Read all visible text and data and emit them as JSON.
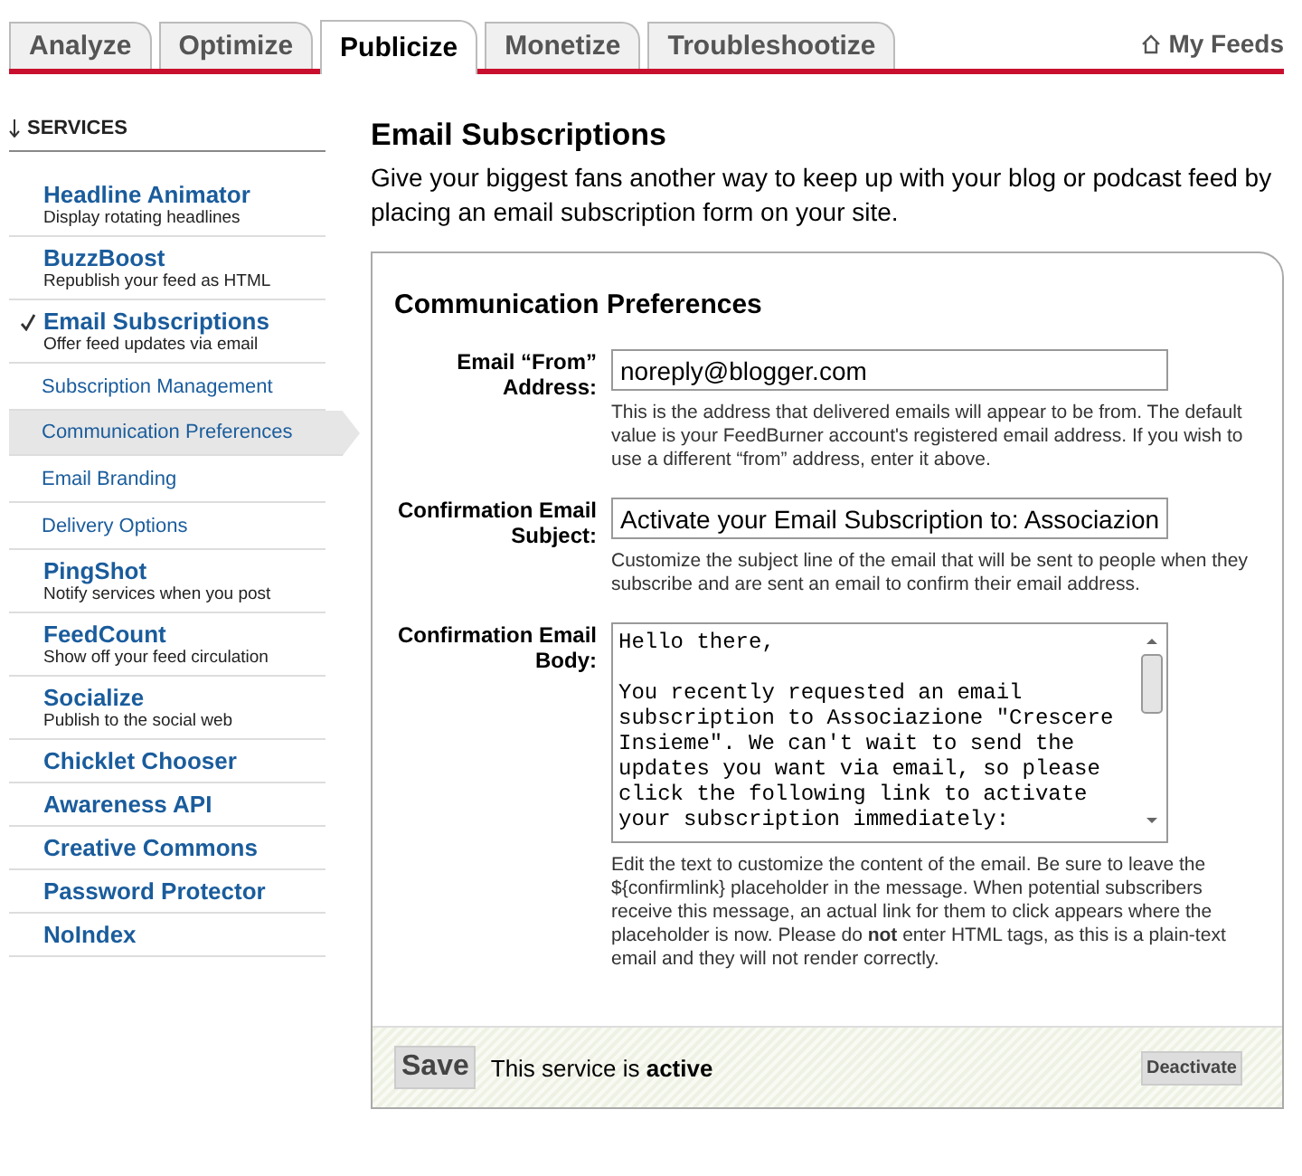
{
  "tabs": [
    {
      "label": "Analyze",
      "selected": false
    },
    {
      "label": "Optimize",
      "selected": false
    },
    {
      "label": "Publicize",
      "selected": true
    },
    {
      "label": "Monetize",
      "selected": false
    },
    {
      "label": "Troubleshootize",
      "selected": false
    }
  ],
  "my_feeds": {
    "label": "My Feeds"
  },
  "sidebar": {
    "heading": "SERVICES",
    "items": [
      {
        "kind": "service",
        "title": "Headline Animator",
        "description": "Display rotating headlines",
        "checked": false
      },
      {
        "kind": "service",
        "title": "BuzzBoost",
        "description": "Republish your feed as HTML",
        "checked": false
      },
      {
        "kind": "service",
        "title": "Email Subscriptions",
        "description": "Offer feed updates via email",
        "checked": true,
        "children": [
          {
            "title": "Subscription Management",
            "selected": false
          },
          {
            "title": "Communication Preferences",
            "selected": true
          },
          {
            "title": "Email Branding",
            "selected": false
          },
          {
            "title": "Delivery Options",
            "selected": false
          }
        ]
      },
      {
        "kind": "service",
        "title": "PingShot",
        "description": "Notify services when you post",
        "checked": false
      },
      {
        "kind": "service",
        "title": "FeedCount",
        "description": "Show off your feed circulation",
        "checked": false
      },
      {
        "kind": "service",
        "title": "Socialize",
        "description": "Publish to the social web",
        "checked": false
      },
      {
        "kind": "plain",
        "title": "Chicklet Chooser"
      },
      {
        "kind": "plain",
        "title": "Awareness API"
      },
      {
        "kind": "plain",
        "title": "Creative Commons"
      },
      {
        "kind": "plain",
        "title": "Password Protector"
      },
      {
        "kind": "plain",
        "title": "NoIndex"
      }
    ]
  },
  "page": {
    "title": "Email Subscriptions",
    "intro": "Give your biggest fans another way to keep up with your blog or podcast feed by placing an email subscription form on your site."
  },
  "panel": {
    "title": "Communication Preferences",
    "fields": [
      {
        "kind": "input",
        "label": "Email “From” Address:",
        "value": "noreply@blogger.com",
        "help": "This is the address that delivered emails will appear to be from. The default value is your FeedBurner account's registered email address. If you wish to use a different “from” address, enter it above."
      },
      {
        "kind": "input",
        "label": "Confirmation Email Subject:",
        "value": "Activate your Email Subscription to: Associazion",
        "help": "Customize the subject line of the email that will be sent to people when they subscribe and are sent an email to confirm their email address."
      },
      {
        "kind": "textarea",
        "label": "Confirmation Email Body:",
        "value": "Hello there,\n\nYou recently requested an email subscription to Associazione \"Crescere Insieme\". We can't wait to send the updates you want via email, so please click the following link to activate your subscription immediately:",
        "help": "Edit the text to customize the content of the email. Be sure to leave the ${confirmlink} placeholder in the message. When potential subscribers receive this message, an actual link for them to click appears where the placeholder is now. Please do **not** enter HTML tags, as this is a plain-text email and they will not render correctly."
      }
    ],
    "save_label": "Save",
    "status": "This service is **active**",
    "deactivate_label": "Deactivate"
  }
}
